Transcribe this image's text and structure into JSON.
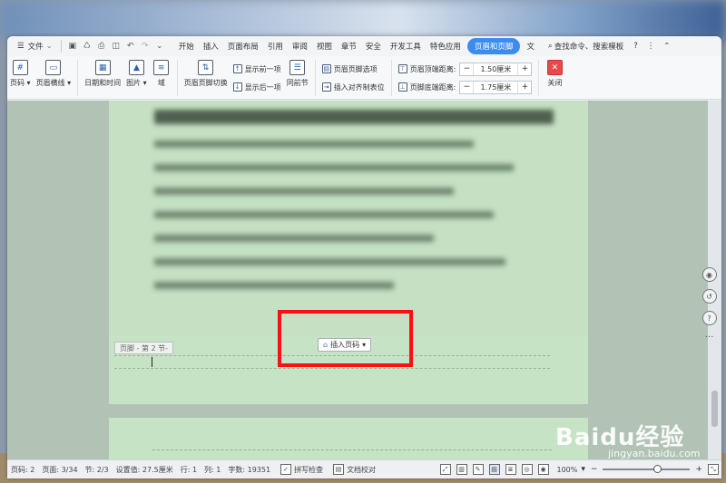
{
  "menubar": {
    "menu_label": "文件",
    "tabs": [
      {
        "label": "开始",
        "active": false
      },
      {
        "label": "插入",
        "active": false
      },
      {
        "label": "页面布局",
        "active": false
      },
      {
        "label": "引用",
        "active": false
      },
      {
        "label": "审阅",
        "active": false
      },
      {
        "label": "视图",
        "active": false
      },
      {
        "label": "章节",
        "active": false
      },
      {
        "label": "安全",
        "active": false
      },
      {
        "label": "开发工具",
        "active": false
      },
      {
        "label": "特色应用",
        "active": false
      },
      {
        "label": "页眉和页脚",
        "active": true
      },
      {
        "label": "文",
        "active": false
      }
    ],
    "search_label": "查找命令、搜索模板",
    "help": "?",
    "more": "⋮",
    "collapse": "⌃"
  },
  "ribbon": {
    "page_number": "页码",
    "header_line": "页眉横线",
    "date_time": "日期和时间",
    "picture": "图片",
    "field": "域",
    "switch_header_footer": "页眉页脚切换",
    "show_prev": "显示前一项",
    "show_next": "显示后一项",
    "same_as_previous": "同前节",
    "hf_options": "页眉页脚选项",
    "insert_align_tab": "插入对齐制表位",
    "header_top_label": "页眉顶端距离:",
    "header_top_value": "1.50厘米",
    "footer_bottom_label": "页脚底端距离:",
    "footer_bottom_value": "1.75厘米",
    "close": "关闭",
    "minus": "−",
    "plus": "+"
  },
  "document": {
    "footer_tag": "页脚 - 第 2 节-",
    "insert_page_number": "插入页码"
  },
  "statusbar": {
    "page_num": "页码: 2",
    "pages": "页面: 3/34",
    "section": "节: 2/3",
    "setting": "设置值: 27.5厘米",
    "row": "行: 1",
    "col": "列: 1",
    "word_count": "字数: 19351",
    "spell_check": "拼写检查",
    "doc_proof": "文档校对",
    "zoom": "100%",
    "zoom_minus": "−",
    "zoom_plus": "+"
  },
  "watermark": {
    "brand": "Baidu经验",
    "url": "jingyan.baidu.com"
  },
  "colors": {
    "active_tab": "#3c8cf0",
    "page_bg": "#c7e3c5",
    "highlight": "#ff1010",
    "close_button": "#e84a4a"
  }
}
